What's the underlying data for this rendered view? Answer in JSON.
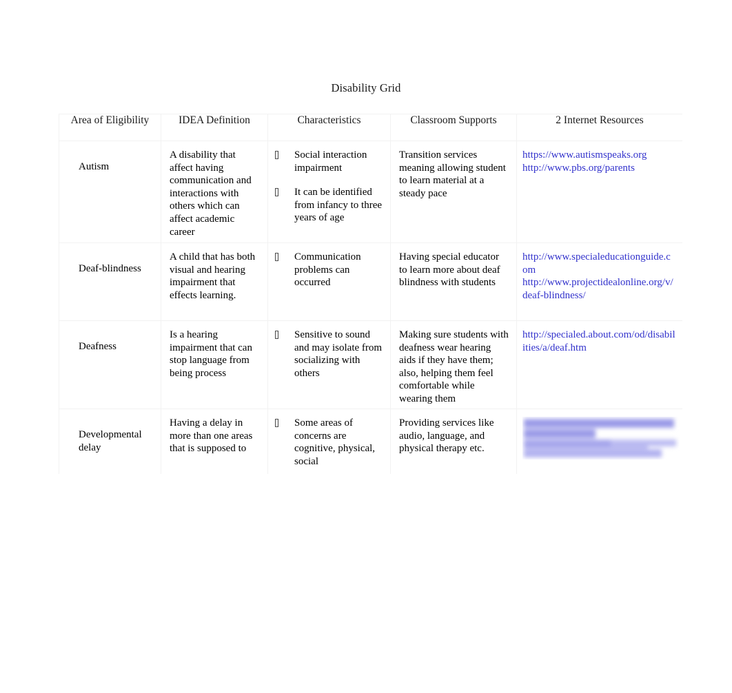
{
  "document": {
    "title": "Disability Grid"
  },
  "table": {
    "headers": [
      "Area of Eligibility",
      "IDEA Definition",
      "Characteristics",
      "Classroom Supports",
      "2 Internet Resources"
    ],
    "rows": [
      {
        "area_of_eligibility": "Autism",
        "idea_definition": "A disability that affect having communication and interactions with others which can affect academic career",
        "characteristics": [
          "Social interaction impairment",
          "It can be identified from infancy to three years of age"
        ],
        "classroom_supports": "Transition services meaning allowing student to learn material at a steady pace",
        "internet_resources": [
          "https://www.autismspeaks.org",
          "http://www.pbs.org/parents"
        ]
      },
      {
        "area_of_eligibility": "Deaf-blindness",
        "idea_definition": "A child that has both visual and hearing impairment that effects learning.",
        "characteristics": [
          "Communication problems can occurred"
        ],
        "classroom_supports": "Having special educator to learn more about deaf blindness with students",
        "internet_resources": [
          "http://www.specialeducationguide.com",
          "http://www.projectidealonline.org/v/deaf-blindness/"
        ]
      },
      {
        "area_of_eligibility": "Deafness",
        "idea_definition": "Is a hearing impairment that can stop language from being process",
        "characteristics": [
          "Sensitive to sound and may isolate from socializing with others"
        ],
        "classroom_supports": " Making sure students with deafness wear hearing aids if they have them; also, helping them feel comfortable while wearing them",
        "internet_resources": [
          "http://specialed.about.com/od/disabilities/a/deaf.htm"
        ]
      },
      {
        "area_of_eligibility": "Developmental delay",
        "idea_definition": "Having a delay in more than one areas that is supposed to",
        "characteristics": [
          "Some areas of concerns are cognitive, physical, social"
        ],
        "classroom_supports": "Providing services like audio, language, and physical therapy etc.",
        "internet_resources": [],
        "internet_resources_redacted": true
      }
    ]
  },
  "colors": {
    "link": "#3333cc",
    "text": "#000000",
    "border": "#f2f2f2",
    "highlight": "#9c9ce8",
    "page_background": "#ffffff"
  }
}
